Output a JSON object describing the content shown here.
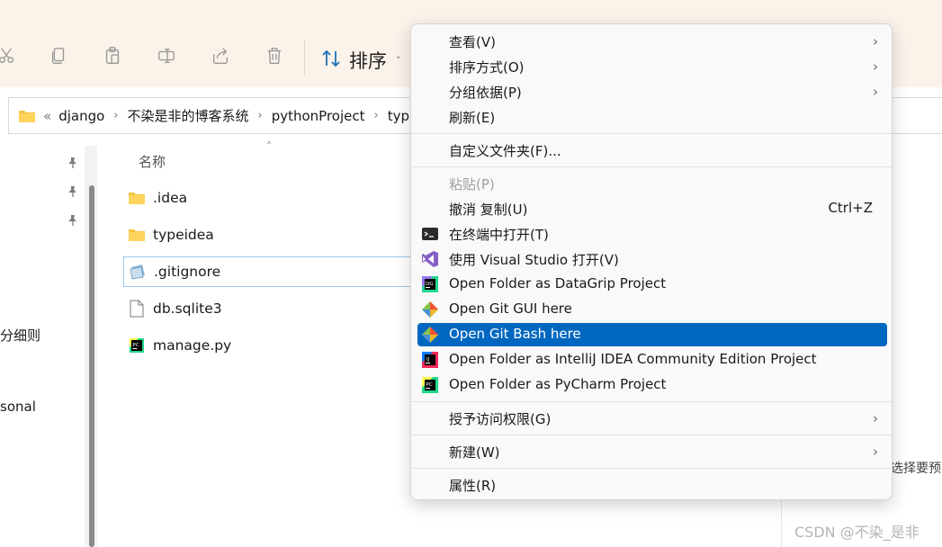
{
  "toolbar": {
    "icons": [
      "cut-icon",
      "copy-icon",
      "paste-icon",
      "rename-icon",
      "share-icon",
      "delete-icon"
    ],
    "sort_label": "排序"
  },
  "address": {
    "lead": "«",
    "crumbs": [
      "django",
      "不染是非的博客系统",
      "pythonProject",
      "typ"
    ]
  },
  "nav": {
    "text1": "分细则",
    "text2": "sonal"
  },
  "files": {
    "column_name": "名称",
    "items": [
      {
        "name": ".idea",
        "icon": "folder-icon"
      },
      {
        "name": "typeidea",
        "icon": "folder-icon"
      },
      {
        "name": ".gitignore",
        "icon": "gitignore-file-icon"
      },
      {
        "name": "db.sqlite3",
        "icon": "blank-file-icon"
      },
      {
        "name": "manage.py",
        "icon": "pycharm-file-icon"
      }
    ]
  },
  "menu": {
    "view": "查看(V)",
    "sort_by": "排序方式(O)",
    "group_by": "分组依据(P)",
    "refresh": "刷新(E)",
    "customize": "自定义文件夹(F)...",
    "paste": "粘贴(P)",
    "undo": "撤消 复制(U)",
    "undo_shortcut": "Ctrl+Z",
    "open_terminal": "在终端中打开(T)",
    "open_vs": "使用 Visual Studio 打开(V)",
    "datagrip": "Open Folder as DataGrip Project",
    "git_gui": "Open Git GUI here",
    "git_bash": "Open Git Bash here",
    "intellij": "Open Folder as IntelliJ IDEA Community Edition Project",
    "pycharm": "Open Folder as PyCharm Project",
    "grant_access": "授予访问权限(G)",
    "new": "新建(W)",
    "properties": "属性(R)",
    "arrow": "›"
  },
  "preview_hint": "选择要预",
  "watermark": "CSDN @不染_是非",
  "colors": {
    "toolbar_bg": "#fbf3ea",
    "menu_highlight": "#0067c0",
    "menu_bg": "#f9f9f9"
  }
}
